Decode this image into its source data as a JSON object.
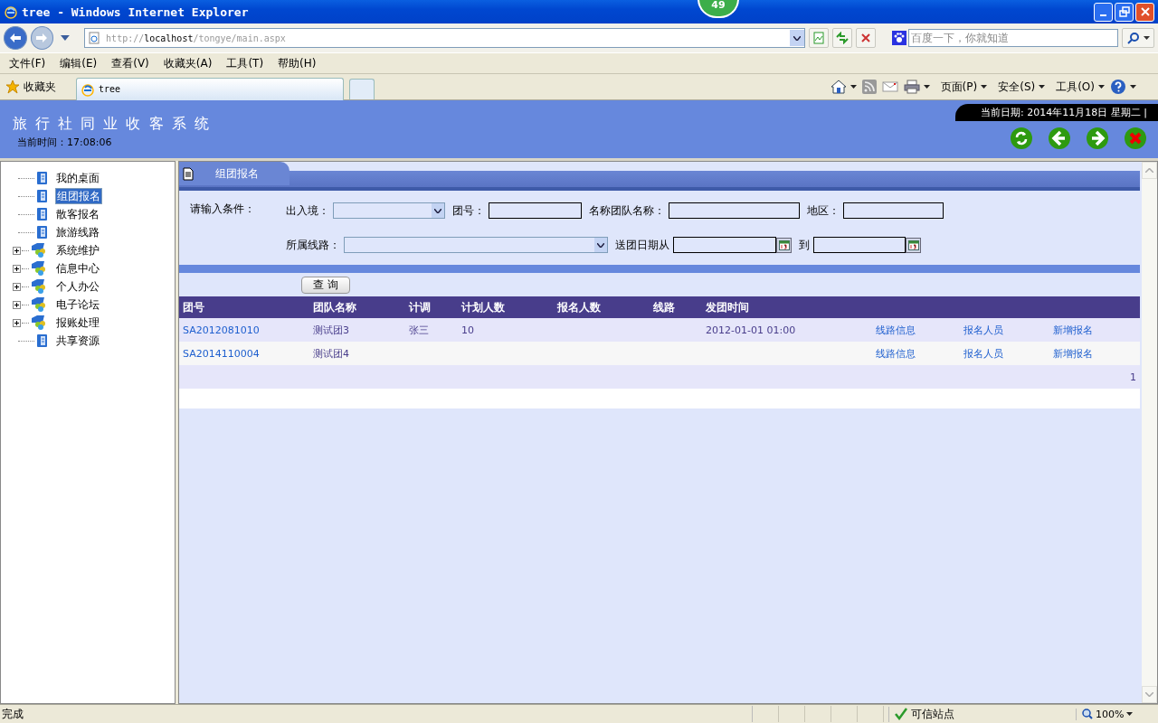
{
  "window": {
    "title": "tree - Windows Internet Explorer",
    "badge": "49"
  },
  "address_bar": {
    "url": "http://**localhost**/tongye/main.aspx"
  },
  "search": {
    "placeholder": "百度一下，你就知道"
  },
  "menu": [
    "文件(F)",
    "编辑(E)",
    "查看(V)",
    "收藏夹(A)",
    "工具(T)",
    "帮助(H)"
  ],
  "favorites": {
    "label": "收藏夹",
    "tab": "tree"
  },
  "command_bar": [
    "页面(P)",
    "安全(S)",
    "工具(O)"
  ],
  "app_header": {
    "title": "旅 行 社 同 业 收 客 系 统",
    "time": "当前时间：17:08:06",
    "date": "当前日期: 2014年11月18日 星期二 |"
  },
  "sidebar": {
    "items": [
      {
        "label": "我的桌面",
        "kind": "page",
        "selected": false
      },
      {
        "label": "组团报名",
        "kind": "page",
        "selected": true
      },
      {
        "label": "散客报名",
        "kind": "page",
        "selected": false
      },
      {
        "label": "旅游线路",
        "kind": "page",
        "selected": false
      },
      {
        "label": "系统维护",
        "kind": "group",
        "selected": false,
        "expanded": false
      },
      {
        "label": "信息中心",
        "kind": "group",
        "selected": false,
        "expanded": false
      },
      {
        "label": "个人办公",
        "kind": "group",
        "selected": false,
        "expanded": false
      },
      {
        "label": "电子论坛",
        "kind": "group",
        "selected": false,
        "expanded": false
      },
      {
        "label": "报账处理",
        "kind": "group",
        "selected": false,
        "expanded": false
      },
      {
        "label": "共享资源",
        "kind": "page",
        "selected": false
      }
    ]
  },
  "panel": {
    "title": "组团报名",
    "filter_label": "请输入条件：",
    "filters": [
      [
        {
          "label": "出入境：",
          "kind": "select"
        },
        {
          "label": "团号：",
          "kind": "text"
        },
        {
          "label": "名称团队名称：",
          "kind": "text"
        },
        {
          "label": "地区：",
          "kind": "text"
        }
      ],
      [
        {
          "label": "所属线路：",
          "kind": "select"
        },
        {
          "label": "送团日期从",
          "kind": "date"
        },
        {
          "label": "到",
          "kind": "date"
        }
      ]
    ],
    "query_button": "查 询",
    "table": {
      "columns": [
        "团号",
        "团队名称",
        "计调",
        "计划人数",
        "报名人数",
        "线路",
        "发团时间"
      ],
      "rows": [
        {
          "cells": [
            "SA2012081010",
            "测试团3",
            "张三",
            "10",
            "",
            "",
            "2012-01-01  01:00"
          ],
          "actions": [
            "线路信息",
            "报名人员",
            "新增报名"
          ]
        },
        {
          "cells": [
            "SA2014110004",
            "测试团4",
            "",
            "",
            "",
            "",
            ""
          ],
          "actions": [
            "线路信息",
            "报名人员",
            "新增报名"
          ]
        }
      ]
    },
    "pager": "1"
  },
  "status_bar": {
    "text": "完成",
    "zone": "可信站点",
    "zoom": "100%"
  }
}
